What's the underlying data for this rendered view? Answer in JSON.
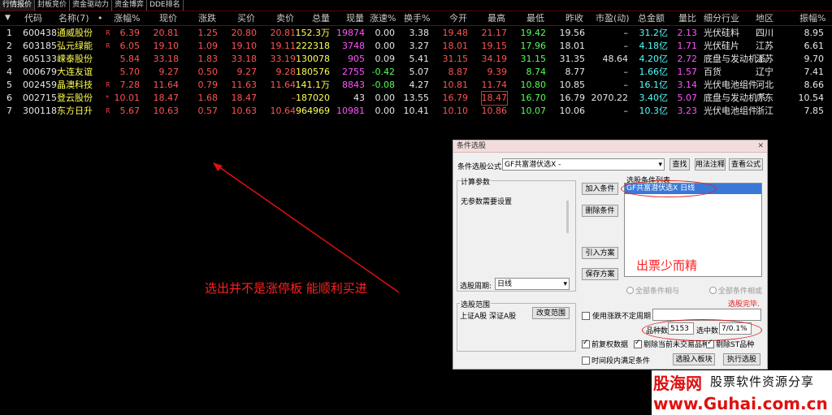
{
  "tabs": [
    "行情报价",
    "封板竞价",
    "资金驱动力",
    "资金博弈",
    "DDE排名"
  ],
  "columns": [
    "代码",
    "名称(7)",
    "•",
    "涨幅%",
    "现价",
    "涨跌",
    "买价",
    "卖价",
    "总量",
    "现量",
    "涨速%",
    "换手%",
    "今开",
    "最高",
    "最低",
    "昨收",
    "市盈(动)",
    "总金额",
    "量比",
    "细分行业",
    "地区",
    "振幅%"
  ],
  "rows": [
    {
      "idx": "1",
      "code": "600438",
      "name": "通威股份",
      "tag": "R",
      "chg": "6.39",
      "price": "20.81",
      "diff": "1.25",
      "bid": "20.80",
      "ask": "20.81",
      "vol": "152.3万",
      "cur": "19874",
      "spd": "0.00",
      "turn": "3.38",
      "open": "19.48",
      "high": "21.17",
      "low": "19.42",
      "prev": "19.56",
      "pe": "–",
      "amt": "31.2亿",
      "vr": "2.13",
      "ind": "光伏硅料",
      "area": "四川",
      "amp": "8.95"
    },
    {
      "idx": "2",
      "code": "603185",
      "name": "弘元绿能",
      "tag": "R",
      "chg": "6.05",
      "price": "19.10",
      "diff": "1.09",
      "bid": "19.10",
      "ask": "19.11",
      "vol": "222318",
      "cur": "3748",
      "spd": "0.00",
      "turn": "3.27",
      "open": "18.01",
      "high": "19.15",
      "low": "17.96",
      "prev": "18.01",
      "pe": "–",
      "amt": "4.18亿",
      "vr": "1.71",
      "ind": "光伏硅片",
      "area": "江苏",
      "amp": "6.61"
    },
    {
      "idx": "3",
      "code": "605133",
      "name": "嵘泰股份",
      "tag": "",
      "chg": "5.84",
      "price": "33.18",
      "diff": "1.83",
      "bid": "33.18",
      "ask": "33.19",
      "vol": "130078",
      "cur": "905",
      "spd": "0.09",
      "turn": "5.41",
      "open": "31.15",
      "high": "34.19",
      "low": "31.15",
      "prev": "31.35",
      "pe": "48.64",
      "amt": "4.20亿",
      "vr": "2.72",
      "ind": "底盘与发动机系",
      "area": "江苏",
      "amp": "9.70"
    },
    {
      "idx": "4",
      "code": "000679",
      "name": "大连友谊",
      "tag": "",
      "chg": "5.70",
      "price": "9.27",
      "diff": "0.50",
      "bid": "9.27",
      "ask": "9.28",
      "vol": "180576",
      "cur": "2755",
      "spd": "-0.42",
      "turn": "5.07",
      "open": "8.87",
      "high": "9.39",
      "low": "8.74",
      "prev": "8.77",
      "pe": "–",
      "amt": "1.66亿",
      "vr": "1.57",
      "ind": "百货",
      "area": "辽宁",
      "amp": "7.41"
    },
    {
      "idx": "5",
      "code": "002459",
      "name": "晶澳科技",
      "tag": "R",
      "chg": "7.28",
      "price": "11.64",
      "diff": "0.79",
      "bid": "11.63",
      "ask": "11.64",
      "vol": "141.1万",
      "cur": "8843",
      "spd": "-0.08",
      "turn": "4.27",
      "open": "10.81",
      "high": "11.74",
      "low": "10.80",
      "prev": "10.85",
      "pe": "–",
      "amt": "16.1亿",
      "vr": "3.14",
      "ind": "光伏电池组件",
      "area": "河北",
      "amp": "8.66"
    },
    {
      "idx": "6",
      "code": "002715",
      "name": "登云股份",
      "tag": "*",
      "chg": "10.01",
      "price": "18.47",
      "diff": "1.68",
      "bid": "18.47",
      "ask": "–",
      "vol": "187020",
      "cur": "43",
      "spd": "0.00",
      "turn": "13.55",
      "open": "16.79",
      "high": "18.47",
      "low": "16.70",
      "prev": "16.79",
      "pe": "2070.22",
      "amt": "3.40亿",
      "vr": "5.07",
      "ind": "底盘与发动机系",
      "area": "广东",
      "amp": "10.54"
    },
    {
      "idx": "7",
      "code": "300118",
      "name": "东方日升",
      "tag": "R",
      "chg": "5.67",
      "price": "10.63",
      "diff": "0.57",
      "bid": "10.63",
      "ask": "10.64",
      "vol": "964969",
      "cur": "10981",
      "spd": "0.00",
      "turn": "10.41",
      "open": "10.10",
      "high": "10.86",
      "low": "10.07",
      "prev": "10.06",
      "pe": "–",
      "amt": "10.3亿",
      "vr": "3.23",
      "ind": "光伏电池组件",
      "area": "浙江",
      "amp": "7.85"
    }
  ],
  "annotations": {
    "left": "选出并不是涨停板 能顺利买进",
    "right": "出票少而精"
  },
  "dialog": {
    "title": "条件选股",
    "formula_label": "条件选股公式",
    "formula_value": "GF共富潜伏选X  -",
    "btn_search": "查找",
    "btn_usage": "用法注释",
    "btn_view": "查看公式",
    "params_title": "计算参数",
    "params_text": "无参数需要设置",
    "btn_add": "加入条件",
    "btn_del": "删除条件",
    "btn_import": "引入方案",
    "btn_save": "保存方案",
    "list_title": "选股条件列表",
    "list_item": "GF共富潜伏选X  日线",
    "period_label": "选股周期:",
    "period_value": "日线",
    "radio_and": "全部条件相与",
    "radio_or": "全部条件相或",
    "status": "选股完毕.",
    "range_title": "选股范围",
    "range_text": "上证A股 深证A股",
    "btn_range": "改变范围",
    "cb_indef": "使用涨跌不定周期",
    "count_label": "品种数",
    "count_value": "5153",
    "sel_label": "选中数",
    "sel_value": "7/0.1%",
    "cb_rights": "前复权数据",
    "cb_notrade": "剔除当前未交易品种",
    "cb_st": "剔除ST品种",
    "cb_time": "时间段内满足条件",
    "btn_toboard": "选股入板块",
    "btn_run": "执行选股"
  },
  "watermark": {
    "brand": "股海网",
    "slogan": "股票软件资源分享",
    "url": "www.Guhai.com.cn"
  }
}
